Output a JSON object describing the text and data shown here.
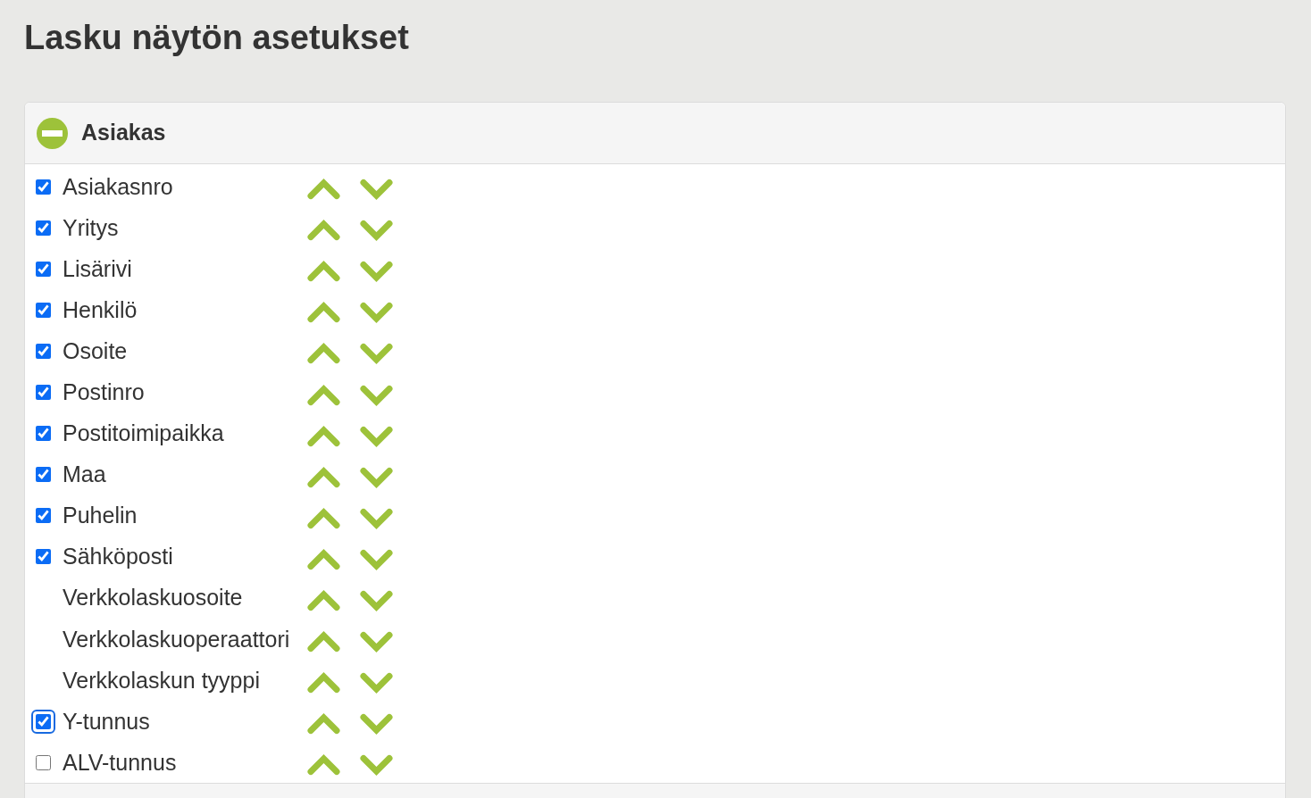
{
  "page": {
    "title": "Lasku näytön asetukset"
  },
  "panel": {
    "title": "Asiakas",
    "expanded": true,
    "fields": [
      {
        "kind": "checkbox",
        "label": "Asiakasnro",
        "checked": true,
        "focused": false
      },
      {
        "kind": "checkbox",
        "label": "Yritys",
        "checked": true,
        "focused": false
      },
      {
        "kind": "checkbox",
        "label": "Lisärivi",
        "checked": true,
        "focused": false
      },
      {
        "kind": "checkbox",
        "label": "Henkilö",
        "checked": true,
        "focused": false
      },
      {
        "kind": "checkbox",
        "label": "Osoite",
        "checked": true,
        "focused": false
      },
      {
        "kind": "checkbox",
        "label": "Postinro",
        "checked": true,
        "focused": false
      },
      {
        "kind": "checkbox",
        "label": "Postitoimipaikka",
        "checked": true,
        "focused": false
      },
      {
        "kind": "checkbox",
        "label": "Maa",
        "checked": true,
        "focused": false
      },
      {
        "kind": "checkbox",
        "label": "Puhelin",
        "checked": true,
        "focused": false
      },
      {
        "kind": "checkbox",
        "label": "Sähköposti",
        "checked": true,
        "focused": false
      },
      {
        "kind": "plain",
        "label": "Verkkolaskuosoite"
      },
      {
        "kind": "plain",
        "label": "Verkkolaskuoperaattori"
      },
      {
        "kind": "plain",
        "label": "Verkkolaskun tyyppi"
      },
      {
        "kind": "checkbox",
        "label": "Y-tunnus",
        "checked": true,
        "focused": true
      },
      {
        "kind": "checkbox",
        "label": "ALV-tunnus",
        "checked": false,
        "focused": false
      }
    ]
  }
}
